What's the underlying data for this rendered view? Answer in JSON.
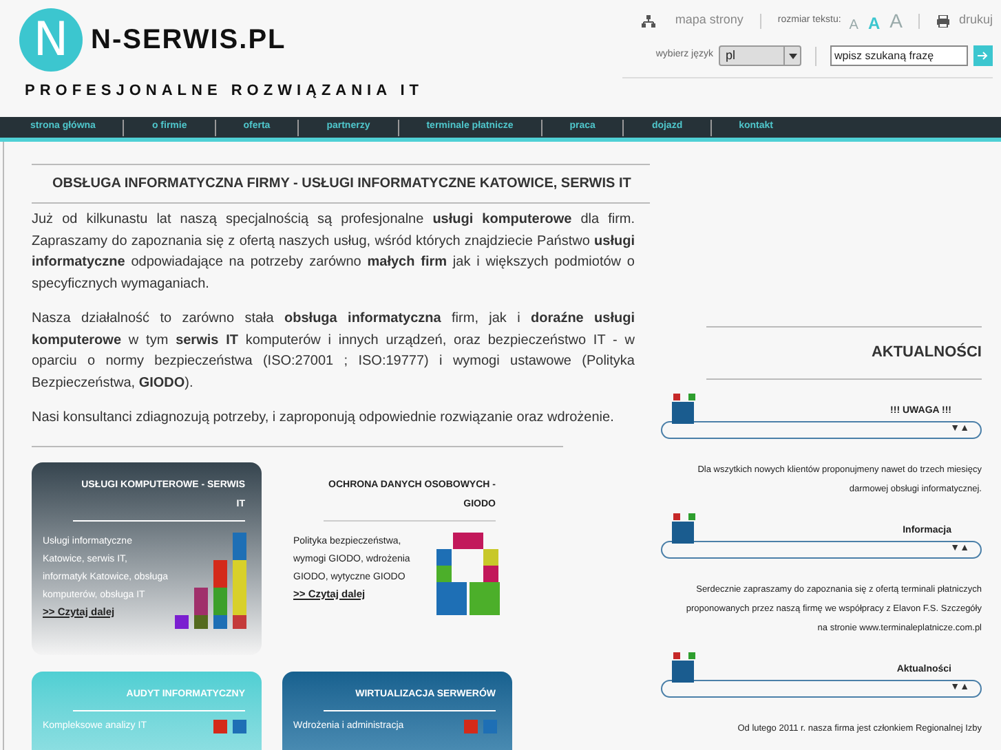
{
  "header": {
    "logo_letter": "N",
    "site_name": "N-SERWIS.PL",
    "tagline": "PROFESJONALNE ROZWIĄZANIA IT",
    "sitemap": "mapa strony",
    "text_size_label": "rozmiar tekstu:",
    "text_sizes": [
      {
        "label": "A",
        "selected": false
      },
      {
        "label": "A",
        "selected": true
      },
      {
        "label": "A",
        "selected": false
      }
    ],
    "print": "drukuj",
    "language_label": "wybierz język",
    "language": "pl",
    "search": {
      "placeholder": "wpisz szukaną frazę"
    }
  },
  "nav": [
    {
      "label": "strona główna"
    },
    {
      "label": "o firmie"
    },
    {
      "label": "oferta"
    },
    {
      "label": "partnerzy"
    },
    {
      "label": "terminale płatnicze"
    },
    {
      "label": "praca"
    },
    {
      "label": "dojazd"
    },
    {
      "label": "kontakt"
    }
  ],
  "article": {
    "title": "OBSŁUGA INFORMATYCZNA FIRMY - USŁUGI INFORMATYCZNE KATOWICE, SERWIS IT",
    "paragraphs": [
      "Już od kilkunastu lat naszą specjalnością są profesjonalne **usługi komputerowe** dla firm. Zapraszamy do zapoznania się z ofertą naszych usług, wśród których znajdziecie Państwo **usługi informatyczne** odpowiadające na potrzeby zarówno **małych firm** jak i większych podmiotów o specyficznych wymaganiach.",
      "Nasza działalność to zarówno stała **obsługa informatyczna** firm, jak i **doraźne usługi komputerowe** w tym **serwis IT** komputerów i innych urządzeń, oraz bezpieczeństwo IT -  w oparciu o normy bezpieczeństwa (ISO:27001 ; ISO:19777) i wymogi ustawowe (Polityka Bezpieczeństwa, **GIODO**).",
      "Nasi konsultanci zdiagnozują potrzeby, i zaproponują odpowiednie rozwiązanie oraz wdrożenie."
    ]
  },
  "cards": [
    {
      "kind": "dark",
      "title": "USŁUGI KOMPUTEROWE - SERWIS IT",
      "text": "Usługi informatyczne Katowice, serwis IT, informatyk Katowice, obsługa komputerów, obsługa IT",
      "link": ">> Czytaj dalej"
    },
    {
      "kind": "plain",
      "title": "OCHRONA DANYCH OSOBOWYCH - GIODO",
      "text": "Polityka bezpieczeństwa, wymogi GIODO, wdrożenia GIODO, wytyczne GIODO",
      "link": ">> Czytaj dalej"
    },
    {
      "kind": "teal",
      "title": "AUDYT INFORMATYCZNY",
      "text": "Kompleksowe analizy IT"
    },
    {
      "kind": "blue",
      "title": "WIRTUALIZACJA SERWERÓW",
      "text": "Wdrożenia i administracja"
    }
  ],
  "news": {
    "title": "AKTUALNOŚCI",
    "items": [
      {
        "title": "!!! UWAGA !!!",
        "toggle": "▼▲",
        "text": "Dla wszytkich nowych klientów proponujmeny nawet do trzech miesięcy darmowej obsługi informatycznej."
      },
      {
        "title": "Informacja",
        "toggle": "▼▲",
        "text": "Serdecznie zapraszamy do zapoznania się z ofertą terminali płatniczych proponowanych przez naszą firmę we współpracy z Elavon F.S. Szczegóły na stronie www.terminaleplatnicze.com.pl"
      },
      {
        "title": "Aktualności",
        "toggle": "▼▲",
        "text": "Od lutego 2011 r. nasza firma jest członkiem Regionalnej Izby"
      }
    ]
  }
}
